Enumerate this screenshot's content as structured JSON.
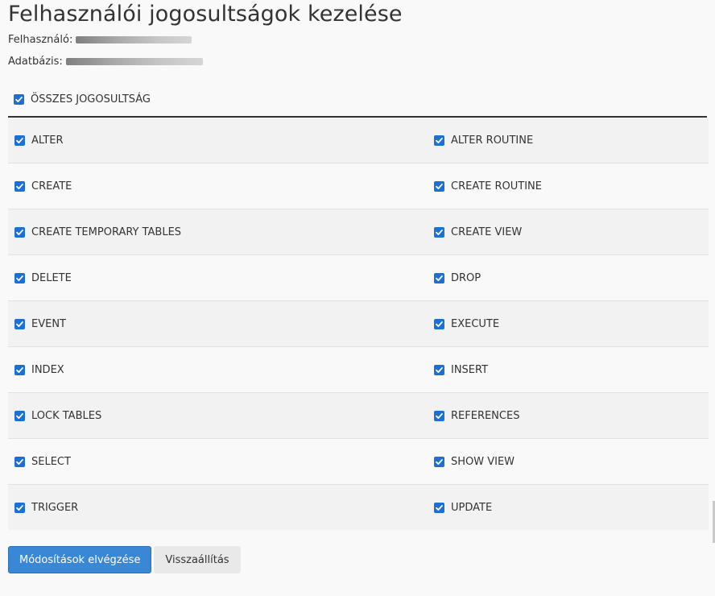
{
  "page": {
    "title": "Felhasználói jogosultságok kezelése",
    "user_label": "Felhasználó:",
    "database_label": "Adatbázis:"
  },
  "all_privileges": {
    "label": "ÖSSZES JOGOSULTSÁG",
    "checked": true
  },
  "privileges": [
    {
      "left": "ALTER",
      "right": "ALTER ROUTINE"
    },
    {
      "left": "CREATE",
      "right": "CREATE ROUTINE"
    },
    {
      "left": "CREATE TEMPORARY TABLES",
      "right": "CREATE VIEW"
    },
    {
      "left": "DELETE",
      "right": "DROP"
    },
    {
      "left": "EVENT",
      "right": "EXECUTE"
    },
    {
      "left": "INDEX",
      "right": "INSERT"
    },
    {
      "left": "LOCK TABLES",
      "right": "REFERENCES"
    },
    {
      "left": "SELECT",
      "right": "SHOW VIEW"
    },
    {
      "left": "TRIGGER",
      "right": "UPDATE"
    }
  ],
  "actions": {
    "submit_label": "Módosítások elvégzése",
    "reset_label": "Visszaállítás"
  },
  "colors": {
    "checkbox": "#1b6fd6",
    "primary_button": "#3a87d6"
  }
}
